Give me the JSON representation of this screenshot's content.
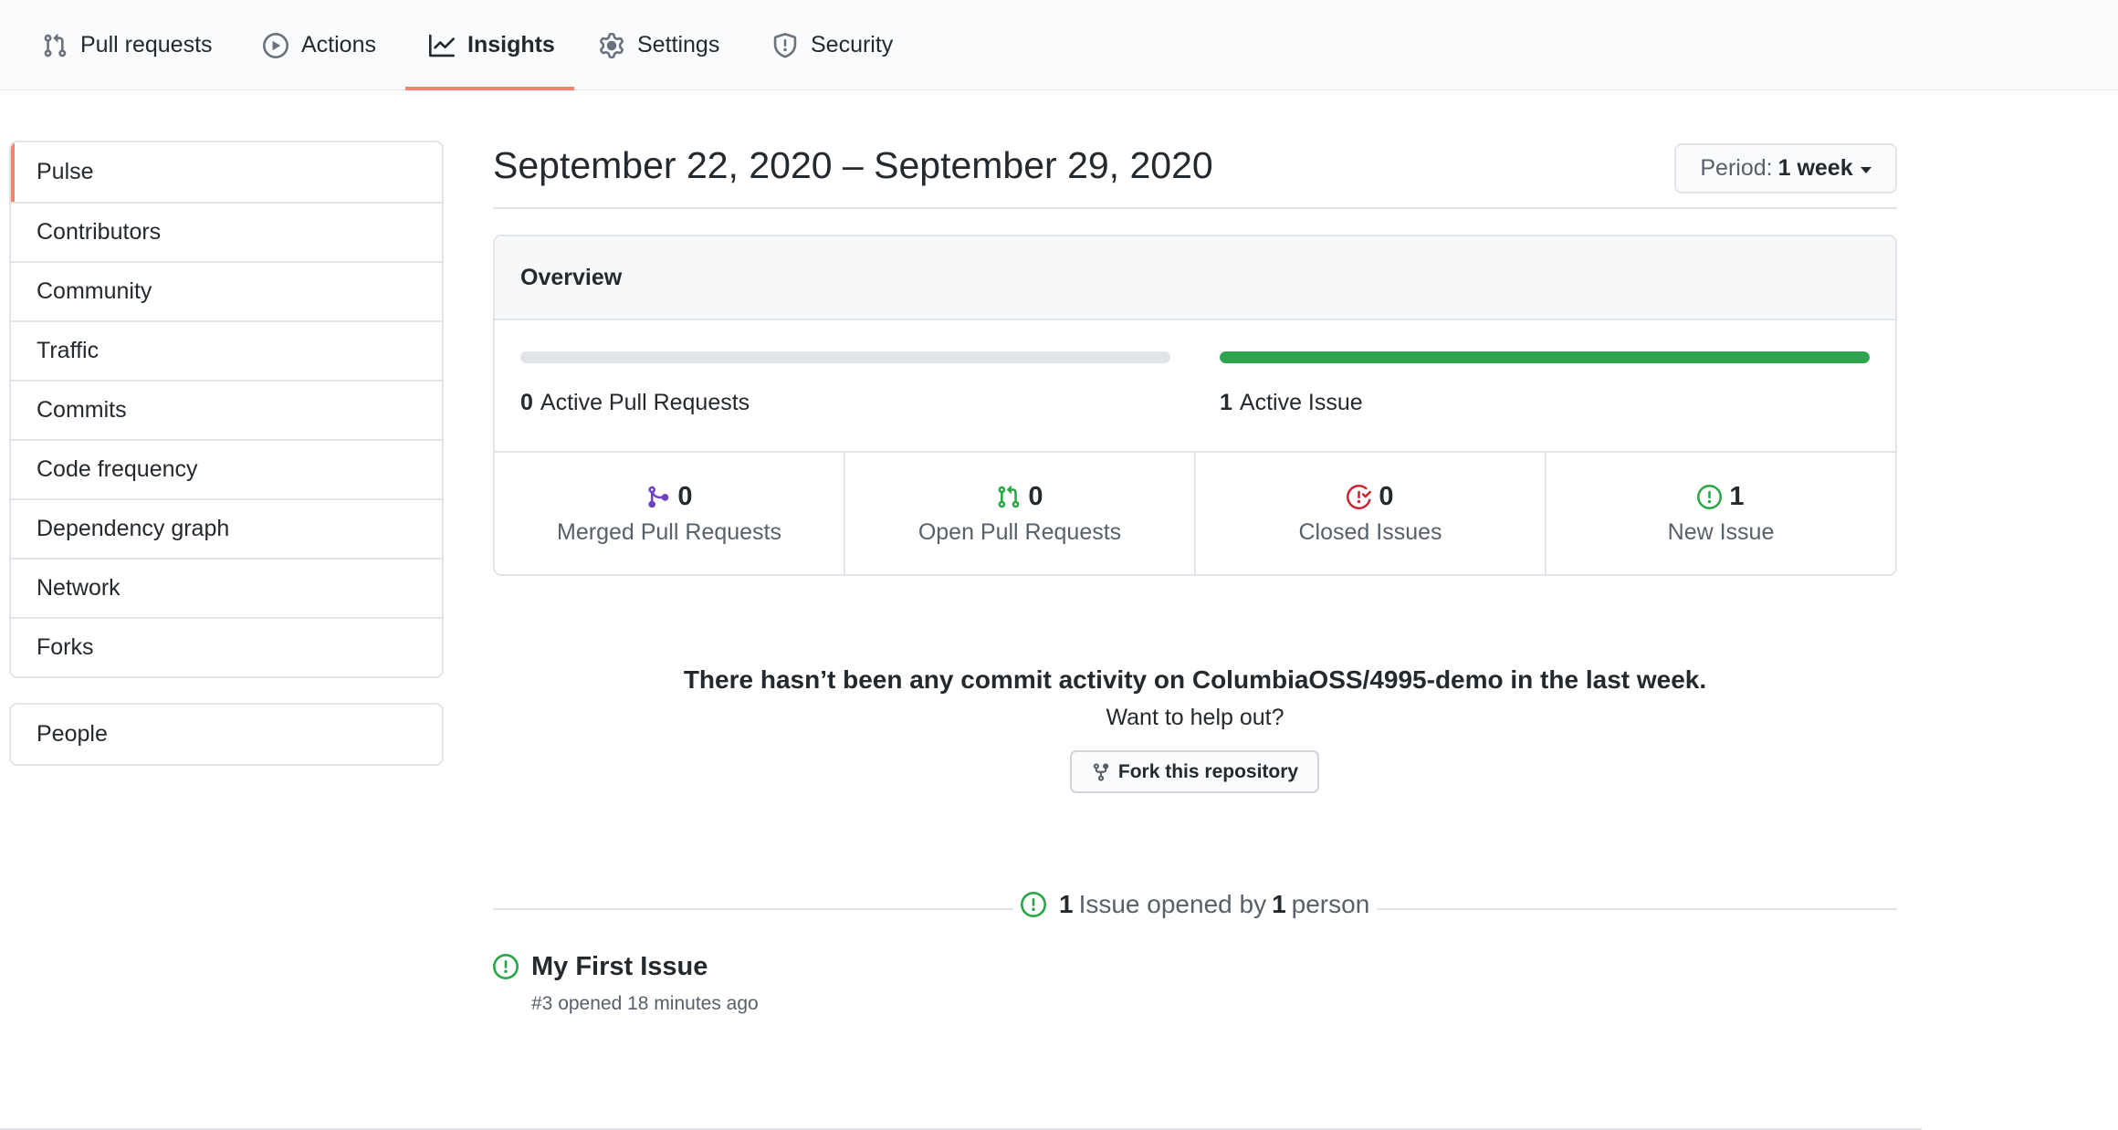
{
  "tabs": [
    {
      "label": "Pull requests",
      "icon": "git-pull-request-icon"
    },
    {
      "label": "Actions",
      "icon": "play-icon"
    },
    {
      "label": "Insights",
      "icon": "graph-icon",
      "active": true
    },
    {
      "label": "Settings",
      "icon": "gear-icon"
    },
    {
      "label": "Security",
      "icon": "shield-icon"
    }
  ],
  "sidebar": {
    "items": [
      "Pulse",
      "Contributors",
      "Community",
      "Traffic",
      "Commits",
      "Code frequency",
      "Dependency graph",
      "Network",
      "Forks"
    ],
    "selected": "Pulse",
    "extra": [
      "People"
    ]
  },
  "header": {
    "date_range": "September 22, 2020 – September 29, 2020",
    "period_prefix": "Period:",
    "period_value": "1 week"
  },
  "overview": {
    "title": "Overview",
    "pull_requests": {
      "count": "0",
      "label": "Active Pull Requests",
      "progress": 0
    },
    "issues": {
      "count": "1",
      "label": "Active Issue",
      "progress": 1
    },
    "stats": [
      {
        "value": "0",
        "label": "Merged Pull Requests",
        "icon": "git-merge-icon",
        "color": "#6f42c1"
      },
      {
        "value": "0",
        "label": "Open Pull Requests",
        "icon": "git-pull-request-icon",
        "color": "#28a745"
      },
      {
        "value": "0",
        "label": "Closed Issues",
        "icon": "issue-closed-icon",
        "color": "#cb2431"
      },
      {
        "value": "1",
        "label": "New Issue",
        "icon": "issue-opened-icon",
        "color": "#28a745"
      }
    ]
  },
  "commits": {
    "message": "There hasn’t been any commit activity on ColumbiaOSS/4995-demo in the last week.",
    "help": "Want to help out?",
    "fork_button": "Fork this repository"
  },
  "issues_summary": {
    "count": "1",
    "text_a": "Issue opened by",
    "people": "1",
    "text_b": "person"
  },
  "issue": {
    "title": "My First Issue",
    "meta": "#3 opened 18 minutes ago"
  },
  "colors": {
    "accent": "#f9826c",
    "green": "#2ea44f",
    "purple": "#6f42c1",
    "red": "#cb2431",
    "border": "#e1e4e8"
  }
}
